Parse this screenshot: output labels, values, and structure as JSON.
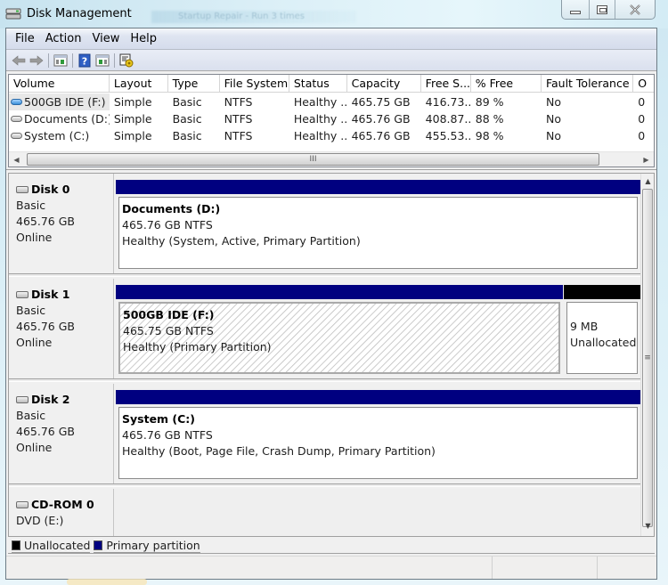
{
  "window": {
    "title": "Disk Management",
    "background_tab_hint": "Startup Repair - Run 3 times",
    "controls": {
      "minimize": "minimize",
      "maximize": "maximize",
      "close": "close"
    }
  },
  "menu": [
    "File",
    "Action",
    "View",
    "Help"
  ],
  "toolbar": {
    "buttons": [
      {
        "name": "back",
        "icon": "arrow-left-icon"
      },
      {
        "name": "forward",
        "icon": "arrow-right-icon"
      },
      {
        "name": "show-hide-console-tree",
        "icon": "console-tree-icon"
      },
      {
        "name": "help",
        "icon": "help-icon"
      },
      {
        "name": "show-hide-action-pane",
        "icon": "action-pane-icon"
      },
      {
        "name": "properties",
        "icon": "properties-icon"
      }
    ]
  },
  "volume_list": {
    "columns": [
      "Volume",
      "Layout",
      "Type",
      "File System",
      "Status",
      "Capacity",
      "Free S...",
      "% Free",
      "Fault Tolerance",
      "O"
    ],
    "rows": [
      {
        "volume": "500GB IDE (F:)",
        "layout": "Simple",
        "type": "Basic",
        "fs": "NTFS",
        "status": "Healthy ...",
        "capacity": "465.75 GB",
        "free": "416.73...",
        "pct_free": "89 %",
        "fault": "No",
        "overhead": "0",
        "selected": true,
        "icon": "blue"
      },
      {
        "volume": "Documents (D:)",
        "layout": "Simple",
        "type": "Basic",
        "fs": "NTFS",
        "status": "Healthy ...",
        "capacity": "465.76 GB",
        "free": "408.87...",
        "pct_free": "88 %",
        "fault": "No",
        "overhead": "0",
        "selected": false,
        "icon": "gray"
      },
      {
        "volume": "System (C:)",
        "layout": "Simple",
        "type": "Basic",
        "fs": "NTFS",
        "status": "Healthy ...",
        "capacity": "465.76 GB",
        "free": "455.53...",
        "pct_free": "98 %",
        "fault": "No",
        "overhead": "0",
        "selected": false,
        "icon": "gray"
      }
    ],
    "hscroll_grip": "III"
  },
  "disks": [
    {
      "name": "Disk 0",
      "type": "Basic",
      "size": "465.76 GB",
      "state": "Online",
      "partitions": [
        {
          "title": "Documents  (D:)",
          "size_fs": "465.76 GB NTFS",
          "status": "Healthy (System, Active, Primary Partition)",
          "kind": "primary",
          "share": 1.0,
          "hatched": false
        }
      ]
    },
    {
      "name": "Disk 1",
      "type": "Basic",
      "size": "465.76 GB",
      "state": "Online",
      "partitions": [
        {
          "title": "500GB IDE  (F:)",
          "size_fs": "465.75 GB NTFS",
          "status": "Healthy (Primary Partition)",
          "kind": "primary",
          "share": 0.852,
          "hatched": true
        },
        {
          "title": "",
          "size_fs": "9 MB",
          "status": "Unallocated",
          "kind": "unallocated",
          "share": 0.148,
          "hatched": false
        }
      ]
    },
    {
      "name": "Disk 2",
      "type": "Basic",
      "size": "465.76 GB",
      "state": "Online",
      "partitions": [
        {
          "title": "System  (C:)",
          "size_fs": "465.76 GB NTFS",
          "status": "Healthy (Boot, Page File, Crash Dump, Primary Partition)",
          "kind": "primary",
          "share": 1.0,
          "hatched": false
        }
      ]
    },
    {
      "name": "CD-ROM 0",
      "type": "DVD (E:)",
      "size": "",
      "state": "",
      "partitions": []
    }
  ],
  "legend": [
    {
      "label": "Unallocated",
      "color": "#000000"
    },
    {
      "label": "Primary partition",
      "color": "#000080"
    }
  ],
  "colors": {
    "primary": "#000080",
    "unallocated": "#000000"
  },
  "vscroll_grip": "≡"
}
